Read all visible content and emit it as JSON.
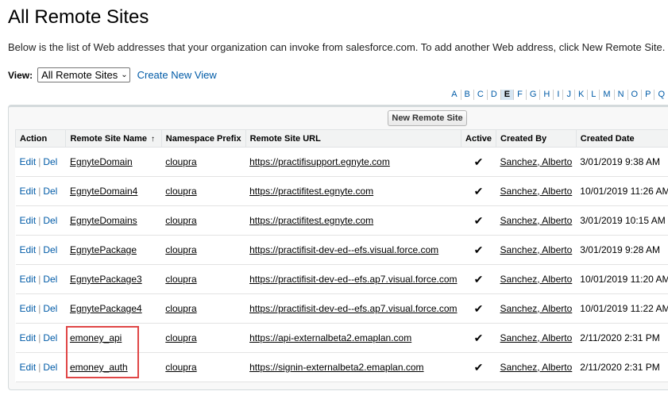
{
  "page": {
    "title": "All Remote Sites",
    "description": "Below is the list of Web addresses that your organization can invoke from salesforce.com. To add another Web address, click New Remote Site."
  },
  "view": {
    "label": "View:",
    "selected": "All Remote Sites",
    "create_link": "Create New View"
  },
  "alphabet": [
    "A",
    "B",
    "C",
    "D",
    "E",
    "F",
    "G",
    "H",
    "I",
    "J",
    "K",
    "L",
    "M",
    "N",
    "O",
    "P",
    "Q"
  ],
  "alphabet_active": "E",
  "list": {
    "new_button": "New Remote Site",
    "columns": {
      "action": "Action",
      "name": "Remote Site Name",
      "sort_icon": "↑",
      "namespace": "Namespace Prefix",
      "url": "Remote Site URL",
      "active": "Active",
      "created_by": "Created By",
      "created_date": "Created Date"
    },
    "edit_label": "Edit",
    "sep": "|",
    "del_label": "Del",
    "check_glyph": "✔",
    "rows": [
      {
        "name": "EgnyteDomain",
        "namespace": "cloupra",
        "url": "https://practifisupport.egnyte.com",
        "active": true,
        "created_by": "Sanchez, Alberto",
        "created_date": "3/01/2019 9:38 AM"
      },
      {
        "name": "EgnyteDomain4",
        "namespace": "cloupra",
        "url": "https://practifitest.egnyte.com",
        "active": true,
        "created_by": "Sanchez, Alberto",
        "created_date": "10/01/2019 11:26 AM"
      },
      {
        "name": "EgnyteDomains",
        "namespace": "cloupra",
        "url": "https://practifitest.egnyte.com",
        "active": true,
        "created_by": "Sanchez, Alberto",
        "created_date": "3/01/2019 10:15 AM"
      },
      {
        "name": "EgnytePackage",
        "namespace": "cloupra",
        "url": "https://practifisit-dev-ed--efs.visual.force.com",
        "active": true,
        "created_by": "Sanchez, Alberto",
        "created_date": "3/01/2019 9:28 AM"
      },
      {
        "name": "EgnytePackage3",
        "namespace": "cloupra",
        "url": "https://practifisit-dev-ed--efs.ap7.visual.force.com",
        "active": true,
        "created_by": "Sanchez, Alberto",
        "created_date": "10/01/2019 11:20 AM"
      },
      {
        "name": "EgnytePackage4",
        "namespace": "cloupra",
        "url": "https://practifisit-dev-ed--efs.ap7.visual.force.com",
        "active": true,
        "created_by": "Sanchez, Alberto",
        "created_date": "10/01/2019 11:22 AM"
      },
      {
        "name": "emoney_api",
        "namespace": "cloupra",
        "url": "https://api-externalbeta2.emaplan.com",
        "active": true,
        "created_by": "Sanchez, Alberto",
        "created_date": "2/11/2020 2:31 PM"
      },
      {
        "name": "emoney_auth",
        "namespace": "cloupra",
        "url": "https://signin-externalbeta2.emaplan.com",
        "active": true,
        "created_by": "Sanchez, Alberto",
        "created_date": "2/11/2020 2:31 PM"
      }
    ]
  },
  "highlight_color": "#e04646",
  "link_color": "#015ba7"
}
